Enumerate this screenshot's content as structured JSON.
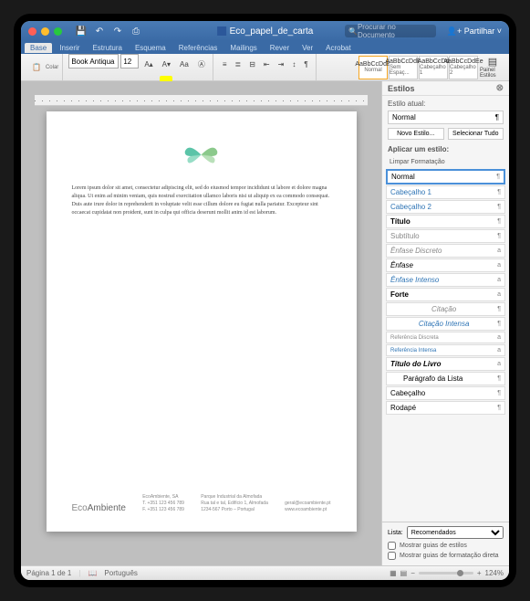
{
  "window": {
    "title": "Eco_papel_de_carta",
    "search_placeholder": "Procurar no Documento",
    "share": "Partilhar"
  },
  "ribbon": {
    "tabs": [
      "Base",
      "Inserir",
      "Estrutura",
      "Esquema",
      "Referências",
      "Mailings",
      "Rever",
      "Ver",
      "Acrobat"
    ],
    "active_tab": 0,
    "font": "Book Antiqua",
    "size": "12",
    "styles": [
      {
        "preview": "AaBbCcDdE",
        "name": "Normal"
      },
      {
        "preview": "AaBbCcDdE",
        "name": "Sem Espaç..."
      },
      {
        "preview": "AaBbCcDd",
        "name": "Cabeçalho 1"
      },
      {
        "preview": "AaBbCcDdEe",
        "name": "Cabeçalho 2"
      }
    ],
    "panel_label": "Painel Estilos"
  },
  "document": {
    "body": "Lorem ipsum dolor sit amet, consectetur adipiscing elit, sed do eiusmod tempor incididunt ut labore et dolore magna aliqua. Ut enim ad minim veniam, quis nostrud exercitation ullamco laboris nisi ut aliquip ex ea commodo consequat. Duis aute irure dolor in reprehenderit in voluptate velit esse cillum dolore eu fugiat nulla pariatur. Excepteur sint occaecat cupidatat non proident, sunt in culpa qui officia deserunt mollit anim id est laborum.",
    "brand_light": "Eco",
    "brand_bold": "Ambiente",
    "footer1": "EcoAmbiente, SA\nT. +351 123 456 789\nF. +351 123 456 789",
    "footer2": "Parque Industrial da Almofada\nRua tal e tal, Edifício 1, Almofada\n1234-567 Porto – Portugal",
    "footer3": "geral@ecoambiente.pt\nwww.ecoambiente.pt"
  },
  "styles_pane": {
    "title": "Estilos",
    "current_label": "Estilo atual:",
    "current": "Normal",
    "new_style": "Novo Estilo...",
    "select_all": "Selecionar Tudo",
    "apply_label": "Aplicar um estilo:",
    "clear": "Limpar Formatação",
    "items": [
      {
        "name": "Normal",
        "sel": true,
        "mark": "¶"
      },
      {
        "name": "Cabeçalho 1",
        "mark": "¶",
        "color": "#2e74b5"
      },
      {
        "name": "Cabeçalho 2",
        "mark": "¶",
        "color": "#2e74b5"
      },
      {
        "name": "Título",
        "mark": "¶",
        "bold": true
      },
      {
        "name": "Subtítulo",
        "mark": "¶",
        "color": "#888"
      },
      {
        "name": "Ênfase Discreto",
        "mark": "a",
        "italic": true,
        "color": "#888"
      },
      {
        "name": "Ênfase",
        "mark": "a",
        "italic": true
      },
      {
        "name": "Ênfase Intenso",
        "mark": "a",
        "italic": true,
        "color": "#2e74b5"
      },
      {
        "name": "Forte",
        "mark": "a",
        "bold": true
      },
      {
        "name": "Citação",
        "mark": "¶",
        "center": true,
        "italic": true,
        "color": "#888"
      },
      {
        "name": "Citação Intensa",
        "mark": "¶",
        "center": true,
        "italic": true,
        "color": "#2e74b5"
      },
      {
        "name": "Referência Discreta",
        "mark": "a",
        "color": "#888",
        "small": true
      },
      {
        "name": "Referência Intensa",
        "mark": "a",
        "color": "#2e74b5",
        "small": true
      },
      {
        "name": "Título do Livro",
        "mark": "a",
        "bold": true,
        "italic": true
      },
      {
        "name": "Parágrafo da Lista",
        "mark": "¶",
        "indent": true
      },
      {
        "name": "Cabeçalho",
        "mark": "¶"
      },
      {
        "name": "Rodapé",
        "mark": "¶"
      }
    ],
    "list_label": "Lista:",
    "list_value": "Recomendados",
    "show_guides": "Mostrar guias de estilos",
    "show_format_guides": "Mostrar guias de formatação direta"
  },
  "status": {
    "page": "Página 1 de 1",
    "lang": "Português",
    "zoom": "124%"
  }
}
